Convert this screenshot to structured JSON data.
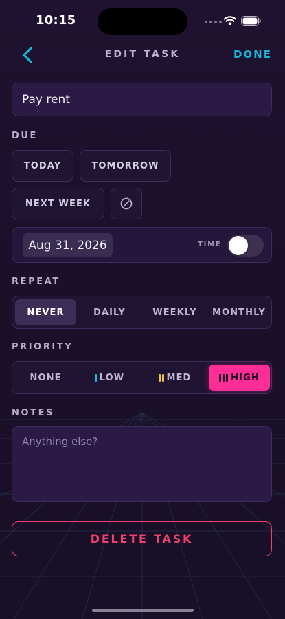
{
  "status_bar": {
    "time": "10:15"
  },
  "nav": {
    "title": "EDIT TASK",
    "done_label": "DONE",
    "back_icon": "chevron-left-icon"
  },
  "task": {
    "title": "Pay rent"
  },
  "due": {
    "label": "DUE",
    "options": [
      "TODAY",
      "TOMORROW",
      "NEXT WEEK"
    ],
    "clear_icon": "no-date-icon",
    "date": "Aug 31, 2026",
    "time_label": "TIME",
    "time_enabled": false
  },
  "repeat": {
    "label": "REPEAT",
    "options": [
      "NEVER",
      "DAILY",
      "WEEKLY",
      "MONTHLY"
    ],
    "selected": "NEVER"
  },
  "priority": {
    "label": "PRIORITY",
    "options": [
      "NONE",
      "LOW",
      "MED",
      "HIGH"
    ],
    "selected": "HIGH",
    "colors": {
      "low": "#20b8e0",
      "med": "#f2c230",
      "high": "#ff2d95"
    }
  },
  "notes": {
    "label": "NOTES",
    "placeholder": "Anything else?"
  },
  "delete": {
    "label": "DELETE TASK",
    "color": "#f0406b"
  },
  "theme": {
    "accent": "#17b5d6",
    "background": "#1a1029"
  }
}
